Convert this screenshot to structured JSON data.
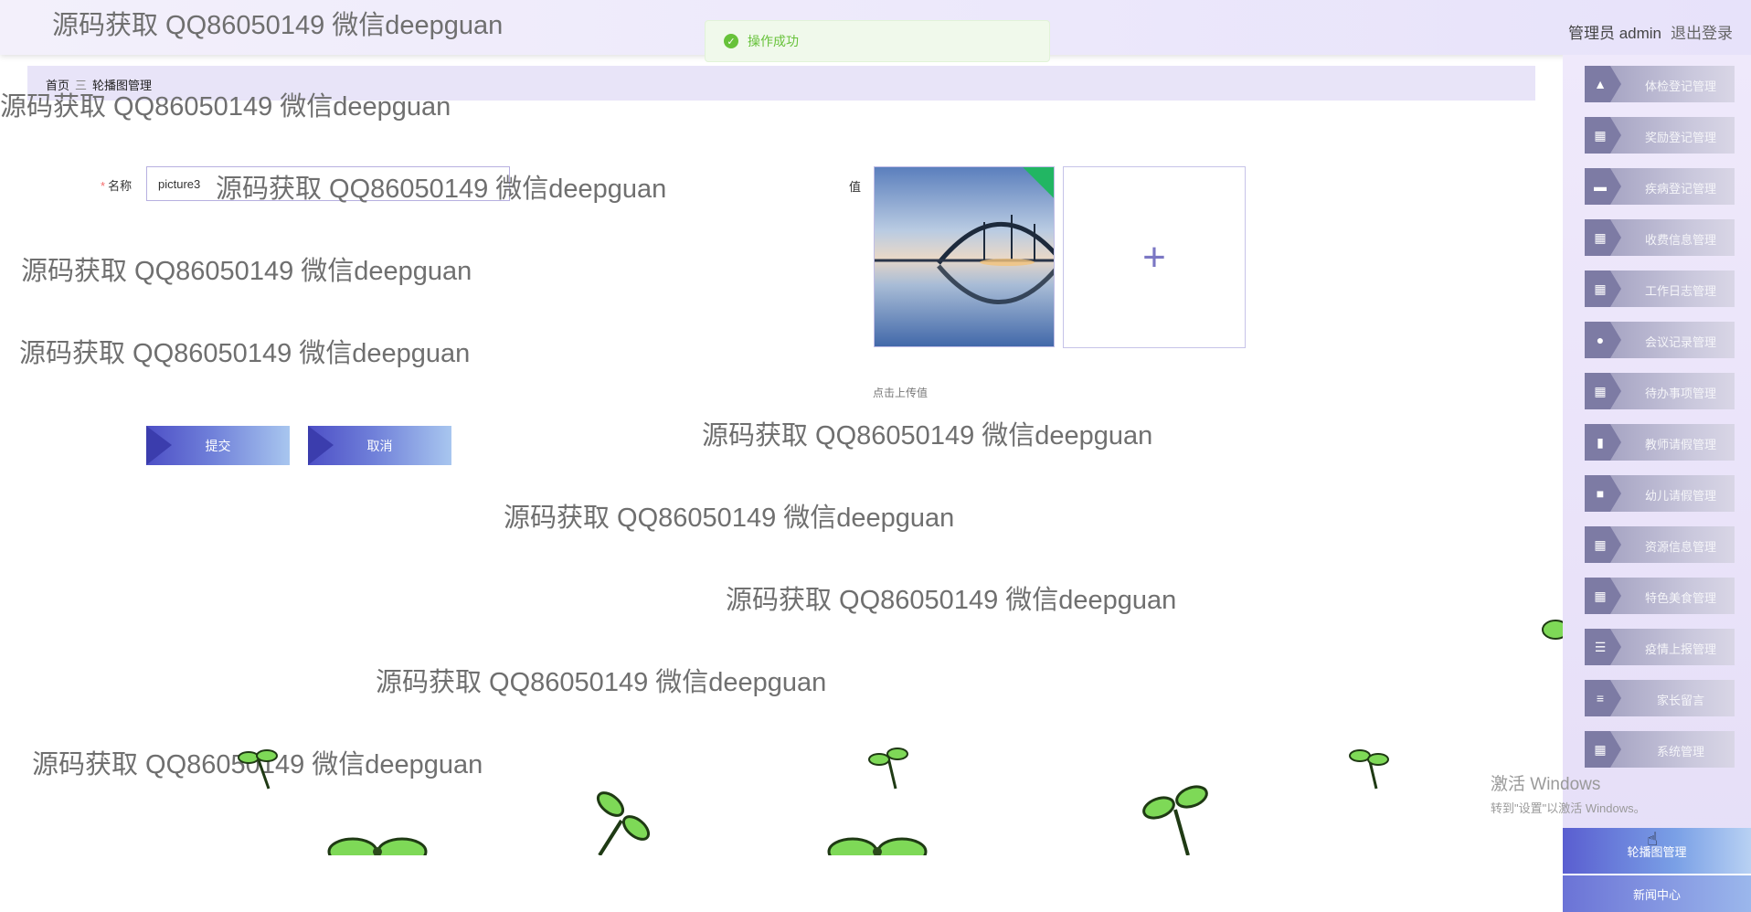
{
  "header": {
    "user_label": "管理员 admin",
    "logout": "退出登录"
  },
  "toast": {
    "message": "操作成功"
  },
  "breadcrumb": {
    "home": "首页",
    "sep": "三",
    "current": "轮播图管理"
  },
  "form": {
    "name_label": "名称",
    "name_value": "picture3",
    "value_label": "值",
    "upload_tip": "点击上传值",
    "submit": "提交",
    "cancel": "取消"
  },
  "sidebar": {
    "items": [
      {
        "label": "体检登记管理",
        "icon": "thumb-icon"
      },
      {
        "label": "奖励登记管理",
        "icon": "grid-icon"
      },
      {
        "label": "疾病登记管理",
        "icon": "monitor-icon"
      },
      {
        "label": "收费信息管理",
        "icon": "grid-icon"
      },
      {
        "label": "工作日志管理",
        "icon": "grid-icon"
      },
      {
        "label": "会议记录管理",
        "icon": "user-icon"
      },
      {
        "label": "待办事项管理",
        "icon": "grid-icon"
      },
      {
        "label": "教师请假管理",
        "icon": "bar-chart-icon"
      },
      {
        "label": "幼儿请假管理",
        "icon": "briefcase-icon"
      },
      {
        "label": "资源信息管理",
        "icon": "grid-icon"
      },
      {
        "label": "特色美食管理",
        "icon": "grid-icon"
      },
      {
        "label": "疫情上报管理",
        "icon": "list-icon"
      },
      {
        "label": "家长留言",
        "icon": "sliders-icon"
      },
      {
        "label": "系统管理",
        "icon": "grid-icon"
      }
    ],
    "active": "轮播图管理",
    "next": "新闻中心"
  },
  "watermark": "源码获取 QQ86050149 微信deepguan",
  "os_overlay": {
    "line1": "激活 Windows",
    "line2": "转到\"设置\"以激活 Windows。"
  }
}
